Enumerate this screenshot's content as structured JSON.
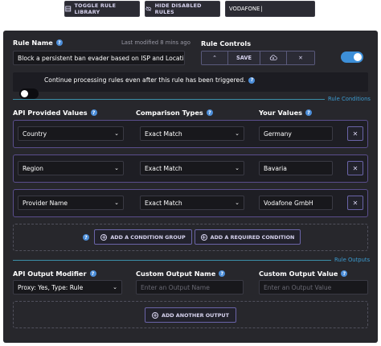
{
  "toolbar": {
    "toggle_rule_library": "TOGGLE RULE LIBRARY",
    "hide_disabled_rules": "HIDE DISABLED RULES",
    "search_value": "VODAFONE"
  },
  "rule": {
    "name_label": "Rule Name",
    "last_modified": "Last modified 8 mins ago",
    "name_value": "Block a persistent ban evader based on ISP and Location",
    "controls_label": "Rule Controls",
    "save_label": "SAVE",
    "enabled": true,
    "continue_text": "Continue processing rules even after this rule has been triggered.",
    "continue_enabled": false
  },
  "conditions": {
    "section_label": "Rule Conditions",
    "col_api": "API Provided Values",
    "col_comparison": "Comparison Types",
    "col_yours": "Your Values",
    "rows": [
      {
        "api": "Country",
        "comparison": "Exact Match",
        "value": "Germany"
      },
      {
        "api": "Region",
        "comparison": "Exact Match",
        "value": "Bavaria"
      },
      {
        "api": "Provider Name",
        "comparison": "Exact Match",
        "value": "Vodafone GmbH"
      }
    ],
    "add_group_label": "ADD A CONDITION GROUP",
    "add_required_label": "ADD A REQUIRED CONDITION"
  },
  "outputs": {
    "section_label": "Rule Outputs",
    "col_modifier": "API Output Modifier",
    "col_name": "Custom Output Name",
    "col_value": "Custom Output Value",
    "modifier_value": "Proxy: Yes, Type: Rule",
    "name_placeholder": "Enter an Output Name",
    "value_placeholder": "Enter an Output Value",
    "add_output_label": "ADD ANOTHER OUTPUT"
  },
  "colors": {
    "accent_blue": "#3d8fd8",
    "purple_border": "#5a4e8c",
    "panel_bg": "#27272c"
  }
}
